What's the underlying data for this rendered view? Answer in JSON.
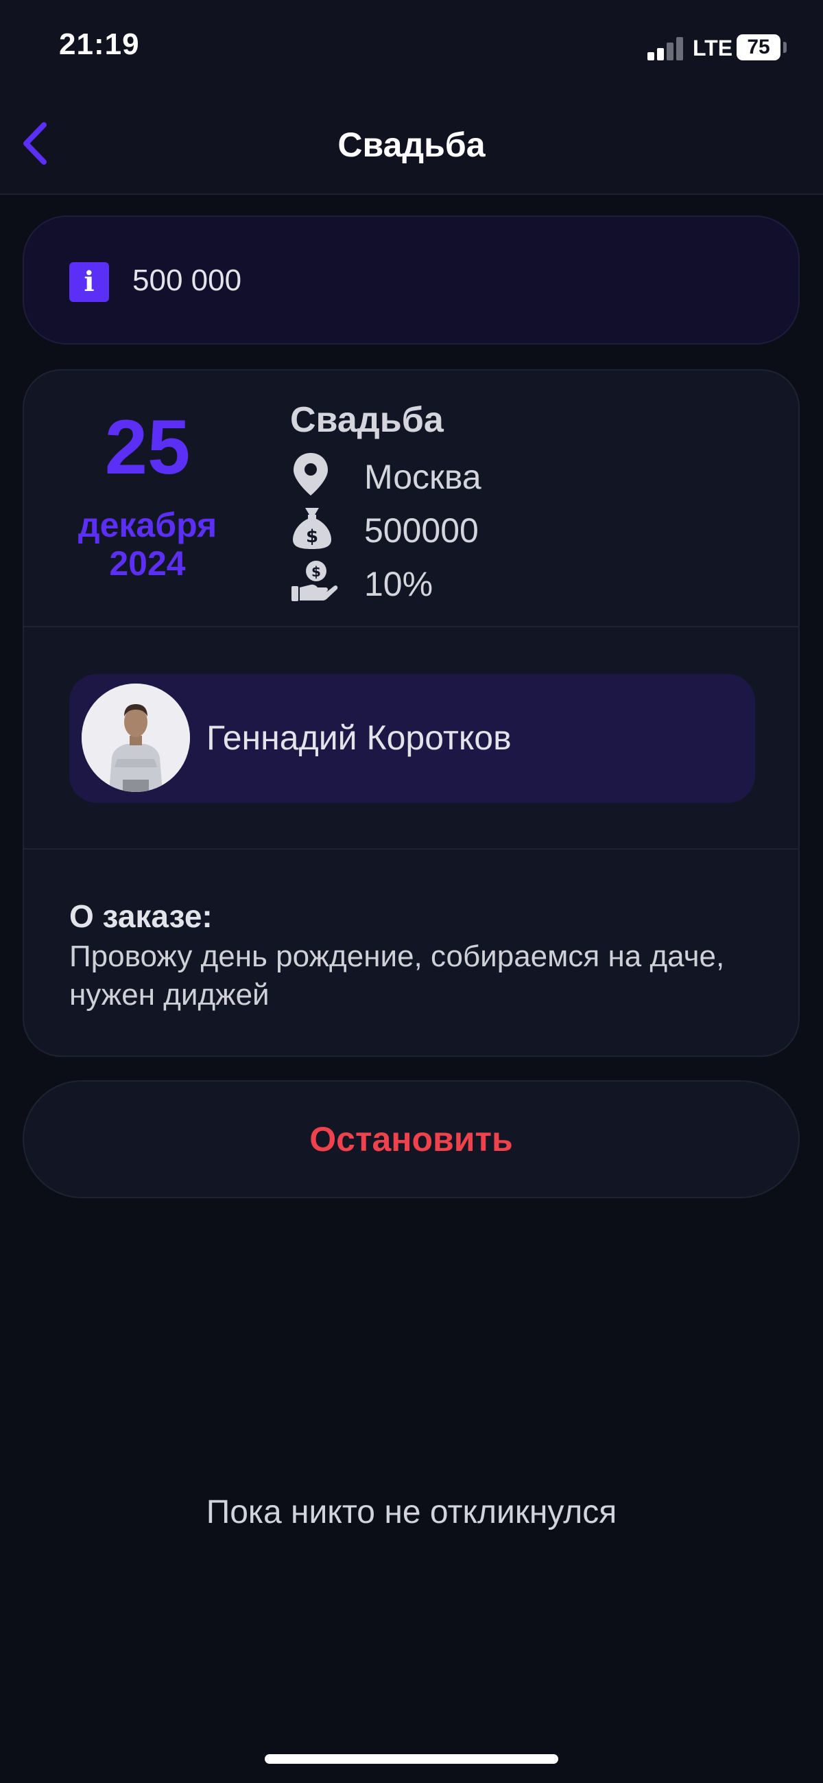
{
  "status_bar": {
    "time": "21:19",
    "network": "LTE",
    "battery": "75"
  },
  "nav": {
    "title": "Свадьба",
    "back_icon": "chevron-left-icon",
    "accent_color": "#5b2ff5"
  },
  "info_banner": {
    "icon": "info-icon",
    "amount": "500 000"
  },
  "order": {
    "date": {
      "day": "25",
      "month": "декабря",
      "year": "2024"
    },
    "title": "Свадьба",
    "details": [
      {
        "icon": "location-pin-icon",
        "text": "Москва"
      },
      {
        "icon": "money-bag-icon",
        "text": "500000"
      },
      {
        "icon": "hand-coin-icon",
        "text": "10%"
      }
    ],
    "author": {
      "name": "Геннадий Коротков"
    },
    "about_label": "О заказе:",
    "about_text": "Провожу день рождение, собираемся на даче, нужен диджей"
  },
  "actions": {
    "stop_label": "Остановить",
    "stop_color": "#f0424c"
  },
  "responses": {
    "empty_text": "Пока никто не откликнулся"
  }
}
